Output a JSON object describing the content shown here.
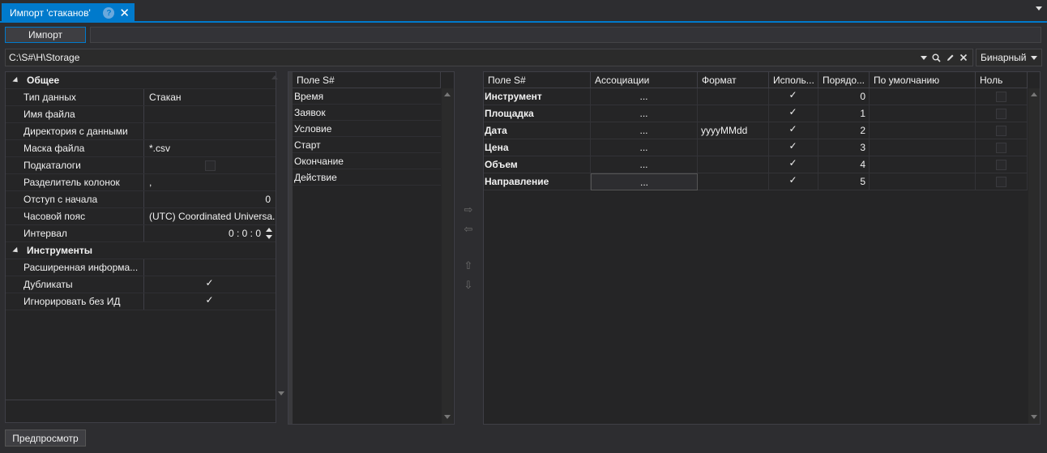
{
  "tab": {
    "title": "Импорт 'стаканов'",
    "pin": "?",
    "close": "✕"
  },
  "toolbar": {
    "import_label": "Импорт"
  },
  "path": {
    "value": "C:\\S#\\H\\Storage",
    "format": "Бинарный"
  },
  "icons": {
    "search": "search-icon",
    "edit": "pencil-icon",
    "clear": "close-icon",
    "dropdown": "chevron-down-icon"
  },
  "colors": {
    "accent": "#007acc",
    "background": "#2d2d30",
    "panel": "#252526"
  },
  "properties": {
    "general_category": "Общее",
    "instruments_category": "Инструменты",
    "data_type": {
      "name": "Тип данных",
      "value": "Стакан"
    },
    "file_name": {
      "name": "Имя файла",
      "value": ""
    },
    "data_dir": {
      "name": "Директория с данными",
      "value": ""
    },
    "file_mask": {
      "name": "Маска файла",
      "value": "*.csv"
    },
    "subdirs": {
      "name": "Подкаталоги",
      "checked": false
    },
    "separator": {
      "name": "Разделитель колонок",
      "value": ","
    },
    "skip_lines": {
      "name": "Отступ с начала",
      "value": "0"
    },
    "timezone": {
      "name": "Часовой пояс",
      "value": "(UTC) Coordinated Universa..."
    },
    "interval": {
      "name": "Интервал",
      "value": "0 : 0 : 0"
    },
    "extended_info": {
      "name": "Расширенная информа...",
      "value": ""
    },
    "duplicates": {
      "name": "Дубликаты",
      "checked": true
    },
    "ignore_no_id": {
      "name": "Игнорировать без ИД",
      "checked": true
    }
  },
  "available_fields": {
    "header": "Поле S#",
    "items": [
      "Время",
      "Заявок",
      "Условие",
      "Старт",
      "Окончание",
      "Действие"
    ]
  },
  "mapping": {
    "headers": {
      "field": "Поле S#",
      "assoc": "Ассоциации",
      "format": "Формат",
      "use": "Исполь...",
      "order": "Порядо...",
      "default": "По умолчанию",
      "zero": "Ноль"
    },
    "rows": [
      {
        "field": "Инструмент",
        "assoc": "...",
        "format": "",
        "use": true,
        "order": "0",
        "default": ""
      },
      {
        "field": "Площадка",
        "assoc": "...",
        "format": "",
        "use": true,
        "order": "1",
        "default": ""
      },
      {
        "field": "Дата",
        "assoc": "...",
        "format": "yyyyMMdd",
        "use": true,
        "order": "2",
        "default": ""
      },
      {
        "field": "Цена",
        "assoc": "...",
        "format": "",
        "use": true,
        "order": "3",
        "default": ""
      },
      {
        "field": "Объем",
        "assoc": "...",
        "format": "",
        "use": true,
        "order": "4",
        "default": ""
      },
      {
        "field": "Направление",
        "assoc": "...",
        "format": "",
        "use": true,
        "order": "5",
        "default": ""
      }
    ]
  },
  "arrows": {
    "right": "⇨",
    "left": "⇦",
    "up": "⇧",
    "down": "⇩"
  },
  "footer": {
    "preview_label": "Предпросмотр"
  }
}
